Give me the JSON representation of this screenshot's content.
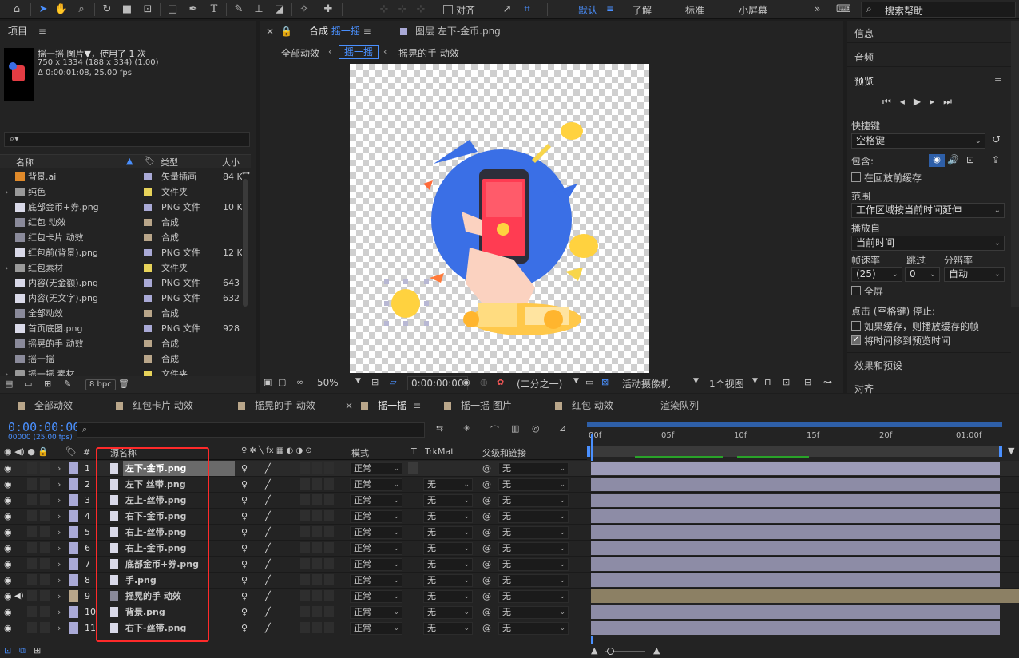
{
  "toolbar": {
    "snap_label": "对齐",
    "workspaces": [
      "默认",
      "了解",
      "标准",
      "小屏幕"
    ],
    "search_placeholder": "搜索帮助"
  },
  "project": {
    "title": "项目",
    "item_name": "摇一摇 图片▼",
    "item_used": "，使用了 1 次",
    "item_dims": "750 x 1334  (188 x 334) (1.00)",
    "item_duration": "Δ 0:00:01:08, 25.00 fps",
    "search_placeholder": "",
    "columns": {
      "name": "名称",
      "type": "类型",
      "size": "大小"
    },
    "items": [
      {
        "name": "背景.ai",
        "type": "矢量插画",
        "size": "84 K",
        "icon": "ai",
        "color": "#a9a9d6",
        "expander": ""
      },
      {
        "name": "纯色",
        "type": "文件夹",
        "size": "",
        "icon": "folder",
        "color": "#e7d35a",
        "expander": "›"
      },
      {
        "name": "底部金币+券.png",
        "type": "PNG 文件",
        "size": "10 K",
        "icon": "file",
        "color": "#a9a9d6",
        "expander": ""
      },
      {
        "name": "红包 动效",
        "type": "合成",
        "size": "",
        "icon": "comp",
        "color": "#b9a68a",
        "expander": ""
      },
      {
        "name": "红包卡片 动效",
        "type": "合成",
        "size": "",
        "icon": "comp",
        "color": "#b9a68a",
        "expander": ""
      },
      {
        "name": "红包前(背景).png",
        "type": "PNG 文件",
        "size": "12 K",
        "icon": "file",
        "color": "#a9a9d6",
        "expander": ""
      },
      {
        "name": "红包素材",
        "type": "文件夹",
        "size": "",
        "icon": "folder",
        "color": "#e7d35a",
        "expander": "›"
      },
      {
        "name": "内容(无金额).png",
        "type": "PNG 文件",
        "size": "643 K",
        "icon": "file",
        "color": "#a9a9d6",
        "expander": ""
      },
      {
        "name": "内容(无文字).png",
        "type": "PNG 文件",
        "size": "632 K",
        "icon": "file",
        "color": "#a9a9d6",
        "expander": ""
      },
      {
        "name": "全部动效",
        "type": "合成",
        "size": "",
        "icon": "comp",
        "color": "#b9a68a",
        "expander": ""
      },
      {
        "name": "首页底图.png",
        "type": "PNG 文件",
        "size": "928 K",
        "icon": "file",
        "color": "#a9a9d6",
        "expander": ""
      },
      {
        "name": "摇晃的手 动效",
        "type": "合成",
        "size": "",
        "icon": "comp",
        "color": "#b9a68a",
        "expander": ""
      },
      {
        "name": "摇一摇",
        "type": "合成",
        "size": "",
        "icon": "comp",
        "color": "#b9a68a",
        "expander": ""
      },
      {
        "name": "摇一摇 素材",
        "type": "文件夹",
        "size": "",
        "icon": "folder",
        "color": "#e7d35a",
        "expander": "›"
      }
    ],
    "bpc": "8 bpc"
  },
  "comp_viewer": {
    "tab_comp_prefix": "合成",
    "tab_comp_name": "摇一摇",
    "tab_layer": "图层 左下-金币.png",
    "breadcrumbs": [
      "全部动效",
      "摇一摇",
      "摇晃的手 动效"
    ],
    "zoom": "50%",
    "timecode": "0:00:00:00",
    "resolution": "(二分之一)",
    "camera": "活动摄像机",
    "views": "1个视图"
  },
  "right_panel": {
    "info": "信息",
    "audio": "音频",
    "preview": "预览",
    "shortcut_label": "快捷键",
    "shortcut_value": "空格键",
    "include_label": "包含:",
    "cache_before": "在回放前缓存",
    "range_label": "范围",
    "range_value": "工作区域按当前时间延伸",
    "play_from_label": "播放自",
    "play_from_value": "当前时间",
    "fps_label": "帧速率",
    "fps_value": "(25)",
    "skip_label": "跳过",
    "skip_value": "0",
    "res_label": "分辨率",
    "res_value": "自动",
    "fullscreen": "全屏",
    "stop_label": "点击 (空格键) 停止:",
    "if_cached": "如果缓存，则播放缓存的帧",
    "move_time": "将时间移到预览时间",
    "effects": "效果和预设",
    "align": "对齐"
  },
  "bottom_tabs": [
    {
      "label": "全部动效",
      "color": "#b9a68a"
    },
    {
      "label": "红包卡片 动效",
      "color": "#b9a68a"
    },
    {
      "label": "摇晃的手 动效",
      "color": "#b9a68a"
    },
    {
      "label": "摇一摇",
      "color": "#b9a68a"
    },
    {
      "label": "摇一摇 图片",
      "color": "#b9a68a"
    },
    {
      "label": "红包 动效",
      "color": "#b9a68a"
    },
    {
      "label": "渲染队列",
      "color": ""
    }
  ],
  "timeline": {
    "timecode": "0:00:00:00",
    "frame_info": "00000 (25.00 fps)",
    "columns": {
      "source": "源名称",
      "mode": "模式",
      "t": "T",
      "trkmat": "TrkMat",
      "parent": "父级和链接"
    },
    "ruler": [
      "00f",
      "05f",
      "10f",
      "15f",
      "20f",
      "01:00f"
    ],
    "layers": [
      {
        "num": "1",
        "name": "左下-金币.png",
        "mode": "正常",
        "trkmat": "",
        "parent": "无",
        "color": "#a9a9d6",
        "kind": "file"
      },
      {
        "num": "2",
        "name": "左下 丝带.png",
        "mode": "正常",
        "trkmat": "无",
        "parent": "无",
        "color": "#a9a9d6",
        "kind": "file"
      },
      {
        "num": "3",
        "name": "左上-丝带.png",
        "mode": "正常",
        "trkmat": "无",
        "parent": "无",
        "color": "#a9a9d6",
        "kind": "file"
      },
      {
        "num": "4",
        "name": "右下-金币.png",
        "mode": "正常",
        "trkmat": "无",
        "parent": "无",
        "color": "#a9a9d6",
        "kind": "file"
      },
      {
        "num": "5",
        "name": "右上-丝带.png",
        "mode": "正常",
        "trkmat": "无",
        "parent": "无",
        "color": "#a9a9d6",
        "kind": "file"
      },
      {
        "num": "6",
        "name": "右上-金币.png",
        "mode": "正常",
        "trkmat": "无",
        "parent": "无",
        "color": "#a9a9d6",
        "kind": "file"
      },
      {
        "num": "7",
        "name": "底部金币+券.png",
        "mode": "正常",
        "trkmat": "无",
        "parent": "无",
        "color": "#a9a9d6",
        "kind": "file"
      },
      {
        "num": "8",
        "name": "手.png",
        "mode": "正常",
        "trkmat": "无",
        "parent": "无",
        "color": "#a9a9d6",
        "kind": "file"
      },
      {
        "num": "9",
        "name": "摇晃的手 动效",
        "mode": "正常",
        "trkmat": "无",
        "parent": "无",
        "color": "#b9a68a",
        "kind": "comp"
      },
      {
        "num": "10",
        "name": "背景.png",
        "mode": "正常",
        "trkmat": "无",
        "parent": "无",
        "color": "#a9a9d6",
        "kind": "file"
      },
      {
        "num": "11",
        "name": "右下-丝带.png",
        "mode": "正常",
        "trkmat": "无",
        "parent": "无",
        "color": "#a9a9d6",
        "kind": "file"
      }
    ]
  }
}
